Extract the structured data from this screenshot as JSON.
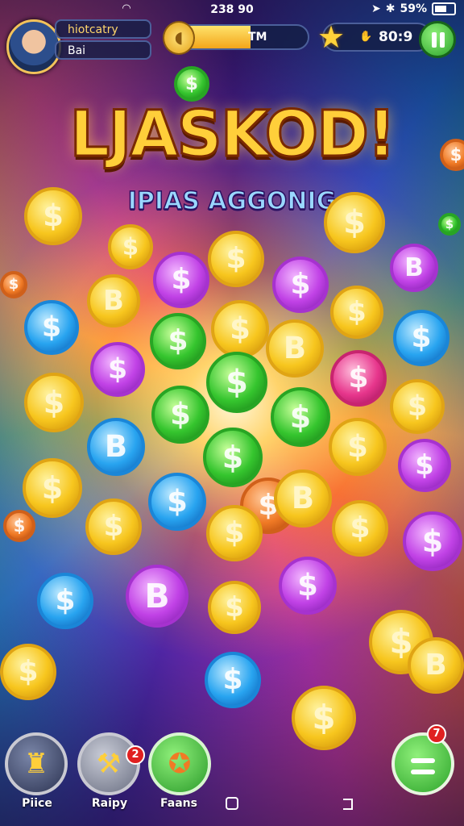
{
  "status_bar": {
    "time": "238 90",
    "battery": "59%",
    "wifi_icon": "wifi-icon",
    "signal_icon": "location-icon"
  },
  "hud": {
    "player_name": "hiotcatry",
    "player_sub": "Bai",
    "progress_label": "TM",
    "progress_fraction": 0.6,
    "score": "80:9"
  },
  "title": "LJASKOD!",
  "subtitle": "IPIAS AGGONIG",
  "coin_symbols": [
    "$",
    "B",
    "฿"
  ],
  "bottom_bar": {
    "prize_label": "Piice",
    "replay_label": "Raipy",
    "feats_label": "Faans",
    "replay_badge": "2",
    "menu_badge": "7"
  },
  "colors": {
    "gold": "#f7c61e",
    "purple": "#c142e6",
    "green": "#35c52e",
    "blue": "#28a4f0",
    "pink": "#e7368c"
  }
}
